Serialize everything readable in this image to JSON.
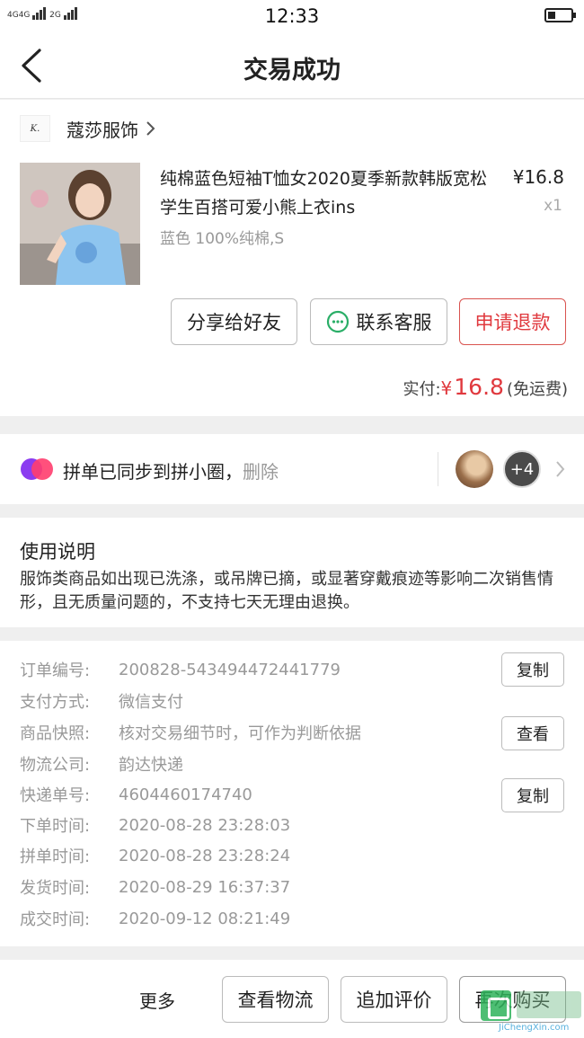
{
  "status_bar": {
    "network_left": "4G",
    "network_left_b": "4G",
    "network_right": "2G",
    "time": "12:33",
    "battery_percent": 35
  },
  "nav": {
    "title": "交易成功"
  },
  "shop": {
    "logo_text": "K.",
    "name": "蔻莎服饰"
  },
  "product": {
    "title": "纯棉蓝色短袖T恤女2020夏季新款韩版宽松学生百搭可爱小熊上衣ins",
    "variant": "蓝色 100%纯棉,S",
    "price": "¥16.8",
    "quantity": "x1"
  },
  "actions": {
    "share": "分享给好友",
    "service": "联系客服",
    "refund": "申请退款"
  },
  "payment": {
    "label": "实付:",
    "currency": "¥",
    "amount": "16.8",
    "shipping_note": "(免运费)"
  },
  "group": {
    "text": "拼单已同步到拼小圈，",
    "delete_label": "删除",
    "more_count": "+4"
  },
  "notes": {
    "title": "使用说明",
    "body": "服饰类商品如出现已洗涤，或吊牌已摘，或显著穿戴痕迹等影响二次销售情形，且无质量问题的，不支持七天无理由退换。"
  },
  "details": {
    "order_no_label": "订单编号:",
    "order_no": "200828-543494472441779",
    "payment_label": "支付方式:",
    "payment_method": "微信支付",
    "snapshot_label": "商品快照:",
    "snapshot_text": "核对交易细节时，可作为判断依据",
    "courier_label": "物流公司:",
    "courier": "韵达快递",
    "tracking_label": "快递单号:",
    "tracking_no": "4604460174740",
    "order_time_label": "下单时间:",
    "order_time": "2020-08-28 23:28:03",
    "group_time_label": "拼单时间:",
    "group_time": "2020-08-28 23:28:24",
    "ship_time_label": "发货时间:",
    "ship_time": "2020-08-29 16:37:37",
    "deal_time_label": "成交时间:",
    "deal_time": "2020-09-12 08:21:49",
    "copy_label": "复制",
    "view_label": "查看"
  },
  "bottom": {
    "more": "更多",
    "logistics": "查看物流",
    "review": "追加评价",
    "rebuy": "再次购买"
  },
  "watermark": {
    "url": "JiChengXin.com"
  },
  "colors": {
    "accent_red": "#e0393e",
    "wechat_green": "#2aae67",
    "group_purple": "#8b3cf0",
    "group_pink": "#ff3d6e"
  }
}
